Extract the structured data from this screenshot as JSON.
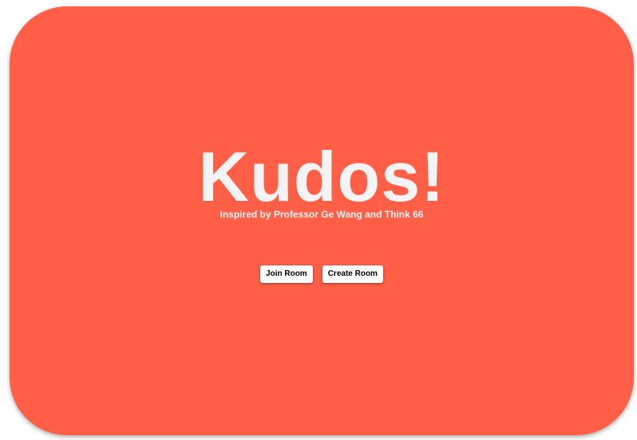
{
  "hero": {
    "title": "Kudos!",
    "subtitle": "Inspired by Professor Ge Wang and Think 66"
  },
  "actions": {
    "join_label": "Join Room",
    "create_label": "Create Room"
  },
  "colors": {
    "card_background": "#ff5f47",
    "text": "#f4f4f4",
    "button_background": "#ffffff"
  }
}
